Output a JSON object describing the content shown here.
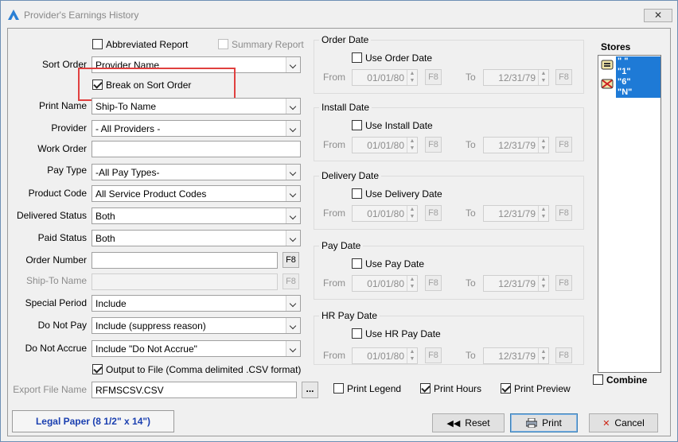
{
  "window": {
    "title": "Provider's Earnings History",
    "close_label": "✕"
  },
  "left": {
    "abbreviated_report": {
      "label": "Abbreviated Report",
      "checked": false
    },
    "summary_report": {
      "label": "Summary Report",
      "checked": false
    },
    "sort_order": {
      "label": "Sort Order",
      "value": "Provider Name"
    },
    "break_on_sort_order": {
      "label": "Break on Sort Order",
      "checked": true
    },
    "print_name": {
      "label": "Print Name",
      "value": "Ship-To Name"
    },
    "provider": {
      "label": "Provider",
      "value": "- All Providers -"
    },
    "work_order": {
      "label": "Work Order",
      "value": ""
    },
    "pay_type": {
      "label": "Pay Type",
      "value": "-All Pay Types-"
    },
    "product_code": {
      "label": "Product Code",
      "value": "All Service Product Codes"
    },
    "delivered_status": {
      "label": "Delivered Status",
      "value": "Both"
    },
    "paid_status": {
      "label": "Paid Status",
      "value": "Both"
    },
    "order_number": {
      "label": "Order Number",
      "value": "",
      "f8": "F8"
    },
    "ship_to_name": {
      "label": "Ship-To Name",
      "value": "",
      "f8": "F8"
    },
    "special_period": {
      "label": "Special Period",
      "value": "Include"
    },
    "do_not_pay": {
      "label": "Do Not Pay",
      "value": "Include (suppress reason)"
    },
    "do_not_accrue": {
      "label": "Do Not Accrue",
      "value": "Include \"Do Not Accrue\""
    },
    "output_to_file": {
      "label": "Output to File (Comma delimited .CSV format)",
      "checked": true
    },
    "export_file_name": {
      "label": "Export File Name",
      "value": "RFMSCSV.CSV",
      "browse": "..."
    }
  },
  "dates": {
    "from_label": "From",
    "to_label": "To",
    "f8": "F8",
    "groups": [
      {
        "title": "Order Date",
        "check": "Use Order Date",
        "from": "01/01/80",
        "to": "12/31/79"
      },
      {
        "title": "Install Date",
        "check": "Use Install Date",
        "from": "01/01/80",
        "to": "12/31/79"
      },
      {
        "title": "Delivery Date",
        "check": "Use Delivery Date",
        "from": "01/01/80",
        "to": "12/31/79"
      },
      {
        "title": "Pay Date",
        "check": "Use Pay Date",
        "from": "01/01/80",
        "to": "12/31/79"
      },
      {
        "title": "HR Pay Date",
        "check": "Use HR Pay Date",
        "from": "01/01/80",
        "to": "12/31/79"
      }
    ]
  },
  "stores": {
    "title": "Stores",
    "items": [
      "\" \"",
      "\"1\"",
      "\"6\"",
      "\"N\""
    ],
    "combine": {
      "label": "Combine",
      "checked": false
    }
  },
  "print_options": {
    "print_legend": {
      "label": "Print Legend",
      "checked": false
    },
    "print_hours": {
      "label": "Print Hours",
      "checked": true
    },
    "print_preview": {
      "label": "Print Preview",
      "checked": true
    }
  },
  "footer": {
    "paper": "Legal Paper (8 1/2\" x 14\")",
    "reset": "Reset",
    "print": "Print",
    "cancel": "Cancel"
  },
  "colors": {
    "accent": "#1e7ad6",
    "highlight_box": "#e0403f",
    "paper_text": "#1a3fb0"
  }
}
